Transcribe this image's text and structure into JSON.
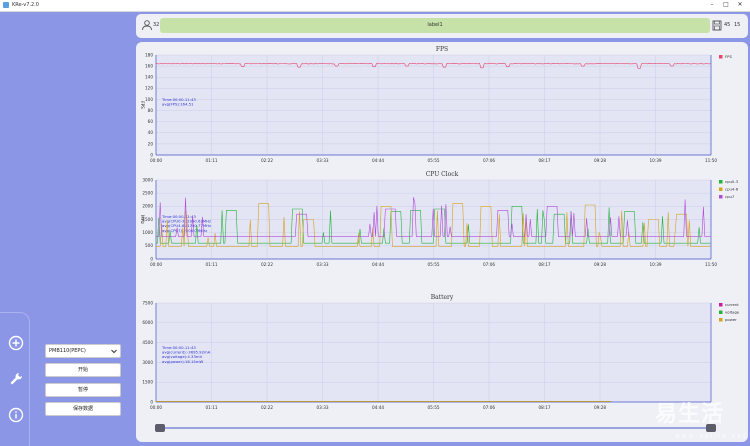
{
  "window": {
    "title": "KRe-v7.2.0"
  },
  "toolbar": {
    "user_count": "32",
    "label": "label1",
    "right_a": "45",
    "right_b": "15"
  },
  "sidebar": {
    "device_select": "PMB110(PEPC)",
    "buttons": {
      "start": "开始",
      "pause": "暂停",
      "save": "保存数据"
    }
  },
  "watermark": {
    "text": "易生活",
    "url": "www.3elife.net"
  },
  "colors": {
    "fps": "#e8446e",
    "cpu0_3": "#22b43a",
    "cpu4_6": "#d5a21e",
    "cpu7": "#b24bd6",
    "current": "#c81e9b",
    "voltage": "#22b43a",
    "power": "#d5a21e"
  },
  "chart_data": [
    {
      "type": "line",
      "title": "FPS",
      "ylabel": "FPS",
      "ylim": [
        0,
        180
      ],
      "yticks": [
        "180",
        "160",
        "140",
        "120",
        "100",
        "80",
        "60",
        "40",
        "20",
        "0"
      ],
      "xticks": [
        "00:00",
        "01:11",
        "02:22",
        "03:33",
        "04:44",
        "05:55",
        "07:06",
        "08:17",
        "09:28",
        "10:39",
        "11:50"
      ],
      "tooltip": [
        "Time:00:00-11:43",
        "avg(FPS):164.51"
      ],
      "legend_position": "top-right",
      "series": [
        {
          "name": "FPS",
          "color_key": "fps",
          "baseline": 164.5,
          "dips": [
            [
              1.85,
              159
            ],
            [
              3.05,
              158
            ],
            [
              3.85,
              160
            ],
            [
              4.65,
              159
            ],
            [
              5.35,
              160
            ],
            [
              6.15,
              158
            ],
            [
              6.95,
              157
            ],
            [
              7.5,
              159
            ],
            [
              9.1,
              160
            ],
            [
              10.3,
              156
            ],
            [
              11.0,
              160
            ]
          ]
        }
      ]
    },
    {
      "type": "line",
      "title": "CPU Clock",
      "ylabel": "MHz",
      "ylim": [
        0,
        3000
      ],
      "yticks": [
        "3000",
        "2500",
        "2000",
        "1500",
        "1000",
        "500",
        "0"
      ],
      "xticks": [
        "00:00",
        "01:11",
        "02:22",
        "03:33",
        "04:44",
        "05:55",
        "07:06",
        "08:17",
        "09:28",
        "10:39",
        "11:50"
      ],
      "tooltip": [
        "Time:00:00-11:43",
        "avg(CPU0-3):1090.63MHz",
        "avg(CPU4-6):1740.77MHz",
        "avg(CPU7):2506.03MHz"
      ],
      "legend_position": "top-right",
      "series": [
        {
          "name": "cpu0-3",
          "color_key": "cpu0_3",
          "base": 600,
          "highs": [
            [
              1.6,
              1850
            ],
            [
              3.0,
              1900
            ],
            [
              5.1,
              1800
            ],
            [
              5.55,
              1850
            ],
            [
              6.05,
              1900
            ],
            [
              7.7,
              2000
            ],
            [
              8.6,
              1700
            ],
            [
              10.1,
              1800
            ]
          ]
        },
        {
          "name": "cpu4-6",
          "color_key": "cpu4_6",
          "base": 480,
          "highs": [
            [
              2.3,
              2100
            ],
            [
              3.25,
              1500
            ],
            [
              4.9,
              2000
            ],
            [
              6.45,
              2100
            ],
            [
              7.05,
              2000
            ],
            [
              9.25,
              2050
            ],
            [
              10.6,
              1500
            ],
            [
              11.2,
              1700
            ]
          ]
        },
        {
          "name": "cpu7",
          "color_key": "cpu7",
          "base": 850,
          "highs": [
            [
              3.1,
              1700
            ],
            [
              5.0,
              1900
            ],
            [
              7.4,
              1850
            ],
            [
              8.45,
              2000
            ]
          ]
        }
      ]
    },
    {
      "type": "line",
      "title": "Battery",
      "ylabel": "",
      "ylim": [
        0,
        7500
      ],
      "yticks": [
        "7500",
        "6000",
        "4500",
        "3000",
        "1500",
        "0"
      ],
      "xticks": [
        "00:00",
        "01:11",
        "02:22",
        "03:33",
        "04:44",
        "05:55",
        "07:06",
        "08:17",
        "09:28"
      ],
      "tooltip": [
        "Time:00:00-11:43",
        "avg(current):-3695.92mA",
        "avg(voltage):4.33mV",
        "avg(power):16.15mW"
      ],
      "legend_position": "top-right",
      "series": [
        {
          "name": "current",
          "color_key": "current",
          "value": 0
        },
        {
          "name": "voltage",
          "color_key": "voltage",
          "value": 0
        },
        {
          "name": "power",
          "color_key": "power",
          "value": 0
        }
      ]
    }
  ]
}
